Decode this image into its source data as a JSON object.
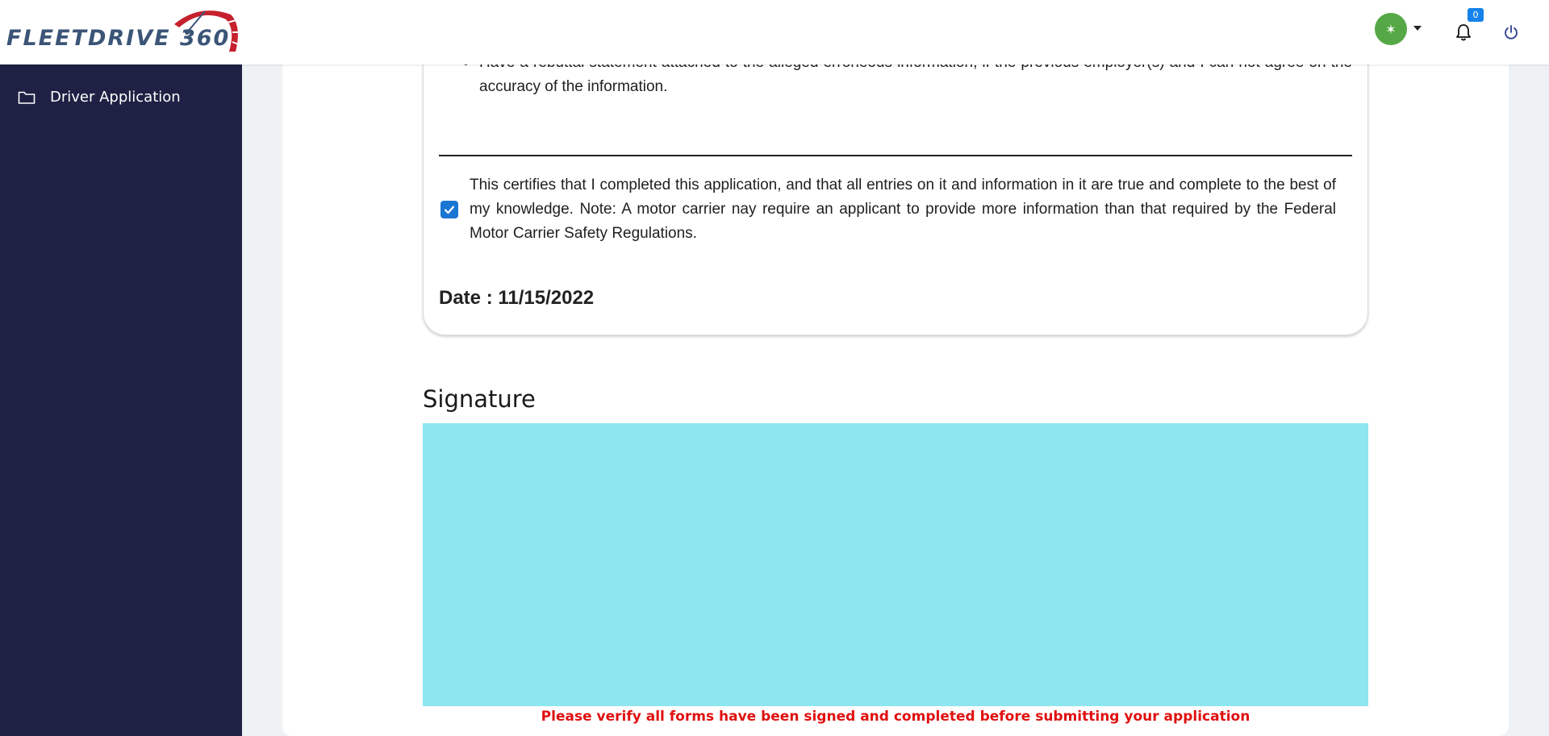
{
  "header": {
    "logo_text": "FLEETDRIVE 360",
    "avatar_initial": "✶",
    "notification_count": "0",
    "colors": {
      "avatar": "#55a845",
      "badge": "#1583ea",
      "logo": "#3b5577",
      "logo_accent": "#c6202e"
    }
  },
  "sidebar": {
    "items": [
      {
        "label": "Driver Application",
        "icon": "folder-icon"
      }
    ]
  },
  "certification": {
    "bullet_text": "Have a rebuttal statement attached to the alleged erroneous information, if the previous employer(s) and I can not agree on the accuracy of the information.",
    "checked": true,
    "statement": "This certifies that I completed this application, and that all entries on it and information in it are true and complete to the best of my knowledge. Note: A motor carrier nay require an applicant to provide more information than that required by the Federal Motor Carrier Safety Regulations.",
    "date_label": "Date : 11/15/2022"
  },
  "signature": {
    "title": "Signature",
    "pad_color": "#8ee6ef",
    "warning": "Please verify all forms have been signed and completed before submitting your application"
  }
}
